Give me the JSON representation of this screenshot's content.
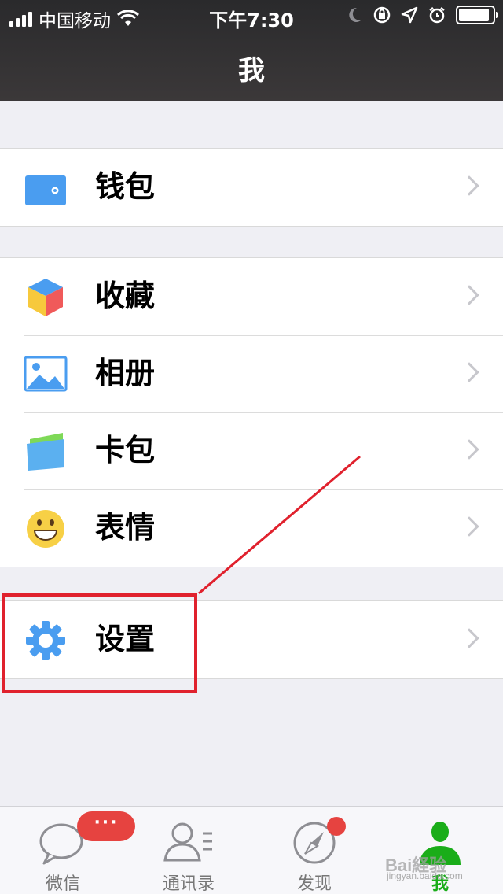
{
  "status_bar": {
    "carrier": "中国移动",
    "time": "下午7:30",
    "battery_level": 0.9
  },
  "nav": {
    "title": "我"
  },
  "groups": [
    {
      "items": [
        {
          "label": "钱包",
          "icon": "wallet-icon"
        }
      ]
    },
    {
      "items": [
        {
          "label": "收藏",
          "icon": "favorites-cube-icon"
        },
        {
          "label": "相册",
          "icon": "album-photo-icon"
        },
        {
          "label": "卡包",
          "icon": "card-bag-icon"
        },
        {
          "label": "表情",
          "icon": "smiley-emoji-icon"
        }
      ]
    },
    {
      "items": [
        {
          "label": "设置",
          "icon": "settings-gear-icon"
        }
      ]
    }
  ],
  "tabbar": {
    "tabs": [
      {
        "label": "微信",
        "icon": "chat-bubble-icon"
      },
      {
        "label": "通讯录",
        "icon": "contacts-icon"
      },
      {
        "label": "发现",
        "icon": "compass-icon"
      },
      {
        "label": "我",
        "icon": "me-person-icon",
        "active": true
      }
    ],
    "chat_badge": "···"
  },
  "watermark": {
    "text": "Bai経验",
    "sub": "jingyan.baidu.com"
  },
  "colors": {
    "accent": "#1aad19",
    "badge": "#e64340",
    "annotation": "#e0212d",
    "icon_blue": "#4a9df0"
  }
}
